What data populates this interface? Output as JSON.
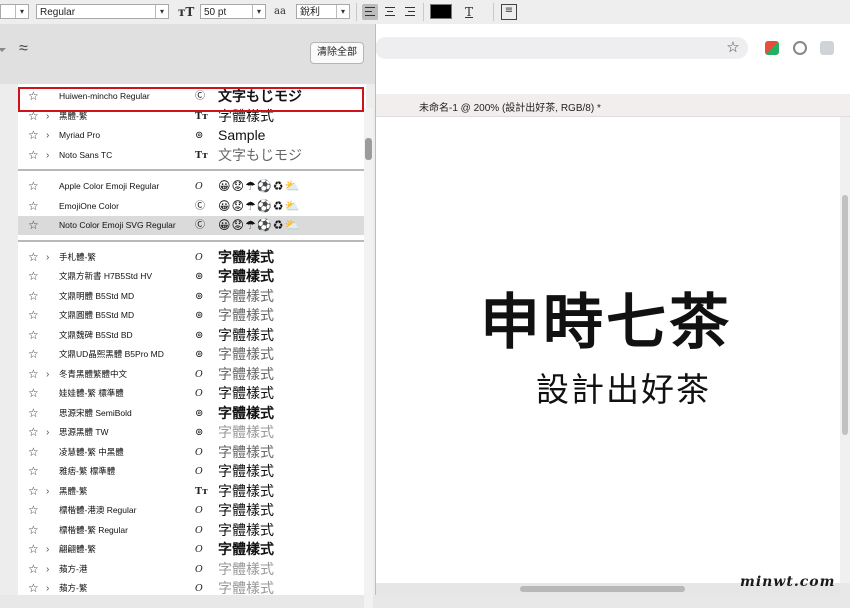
{
  "toolbar": {
    "font_style": "Regular",
    "size_icon": "font-size-T-icon",
    "font_size": "50 pt",
    "antialias_icon": "aa",
    "antialias": "銳利",
    "text_icon": "T"
  },
  "browser": {
    "star": "☆"
  },
  "document": {
    "tab_title": "未命名-1 @ 200% (設計出好茶, RGB/8) *",
    "headline": "申時七茶",
    "subhead": "設計出好茶"
  },
  "panel": {
    "approx_icon": "≈",
    "clear_button": "清除全部"
  },
  "groups": [
    {
      "fonts": [
        {
          "name": "Huiwen-mincho Regular",
          "chev": "",
          "type": "Ⓒ",
          "sample": "文字もじモジ",
          "style": "bold"
        },
        {
          "name": "黑體-繁",
          "chev": "›",
          "type": "Tт",
          "sample": "字體樣式",
          "style": ""
        },
        {
          "name": "Myriad Pro",
          "chev": "›",
          "type": "⊚",
          "sample": "Sample",
          "style": ""
        },
        {
          "name": "Noto Sans TC",
          "chev": "›",
          "type": "Tт",
          "sample": "文字もじモジ",
          "style": "gray"
        }
      ]
    },
    {
      "fonts": [
        {
          "name": "Apple Color Emoji Regular",
          "chev": "",
          "type": "O",
          "sample": "😀😟☂⚽♻⛅",
          "style": "emoji"
        },
        {
          "name": "EmojiOne Color",
          "chev": "",
          "type": "Ⓒ",
          "sample": "😀😟☂⚽♻⛅",
          "style": "emoji"
        },
        {
          "name": "Noto Color Emoji SVG Regular",
          "chev": "",
          "type": "Ⓒ",
          "sample": "😀😟☂⚽♻⛅",
          "style": "emoji"
        }
      ]
    },
    {
      "fonts": [
        {
          "name": "手札體-繁",
          "chev": "›",
          "type": "O",
          "sample": "字體樣式",
          "style": "bold"
        },
        {
          "name": "文鼎方新書 H7B5Std HV",
          "chev": "",
          "type": "⊚",
          "sample": "字體樣式",
          "style": "bold"
        },
        {
          "name": "文鼎明體 B5Std MD",
          "chev": "",
          "type": "⊚",
          "sample": "字體樣式",
          "style": "gray"
        },
        {
          "name": "文鼎圓體 B5Std MD",
          "chev": "",
          "type": "⊚",
          "sample": "字體樣式",
          "style": "gray"
        },
        {
          "name": "文鼎魏碑 B5Std BD",
          "chev": "",
          "type": "⊚",
          "sample": "字體樣式",
          "style": ""
        },
        {
          "name": "文鼎UD晶熙黑體 B5Pro MD",
          "chev": "",
          "type": "⊚",
          "sample": "字體樣式",
          "style": "gray"
        },
        {
          "name": "冬青黑體繁體中文",
          "chev": "›",
          "type": "O",
          "sample": "字體樣式",
          "style": "gray"
        },
        {
          "name": "娃娃體-繁 標準體",
          "chev": "",
          "type": "O",
          "sample": "字體樣式",
          "style": ""
        },
        {
          "name": "思源宋體 SemiBold",
          "chev": "",
          "type": "⊚",
          "sample": "字體樣式",
          "style": "bold"
        },
        {
          "name": "思源黑體 TW",
          "chev": "›",
          "type": "⊚",
          "sample": "字體樣式",
          "style": "light"
        },
        {
          "name": "凌慧體-繁 中黑體",
          "chev": "",
          "type": "O",
          "sample": "字體樣式",
          "style": "gray"
        },
        {
          "name": "雅痞-繁 標準體",
          "chev": "",
          "type": "O",
          "sample": "字體樣式",
          "style": ""
        },
        {
          "name": "黑體-繁",
          "chev": "›",
          "type": "Tт",
          "sample": "字體樣式",
          "style": ""
        },
        {
          "name": "標楷體-港澳 Regular",
          "chev": "",
          "type": "O",
          "sample": "字體樣式",
          "style": ""
        },
        {
          "name": "標楷體-繁 Regular",
          "chev": "",
          "type": "O",
          "sample": "字體樣式",
          "style": ""
        },
        {
          "name": "翩翩體-繁",
          "chev": "›",
          "type": "O",
          "sample": "字體樣式",
          "style": "bold"
        },
        {
          "name": "蘋方-港",
          "chev": "›",
          "type": "O",
          "sample": "字體樣式",
          "style": "light"
        },
        {
          "name": "蘋方-繁",
          "chev": "›",
          "type": "O",
          "sample": "字體樣式",
          "style": "light"
        }
      ]
    }
  ],
  "watermark": "minwt.com"
}
